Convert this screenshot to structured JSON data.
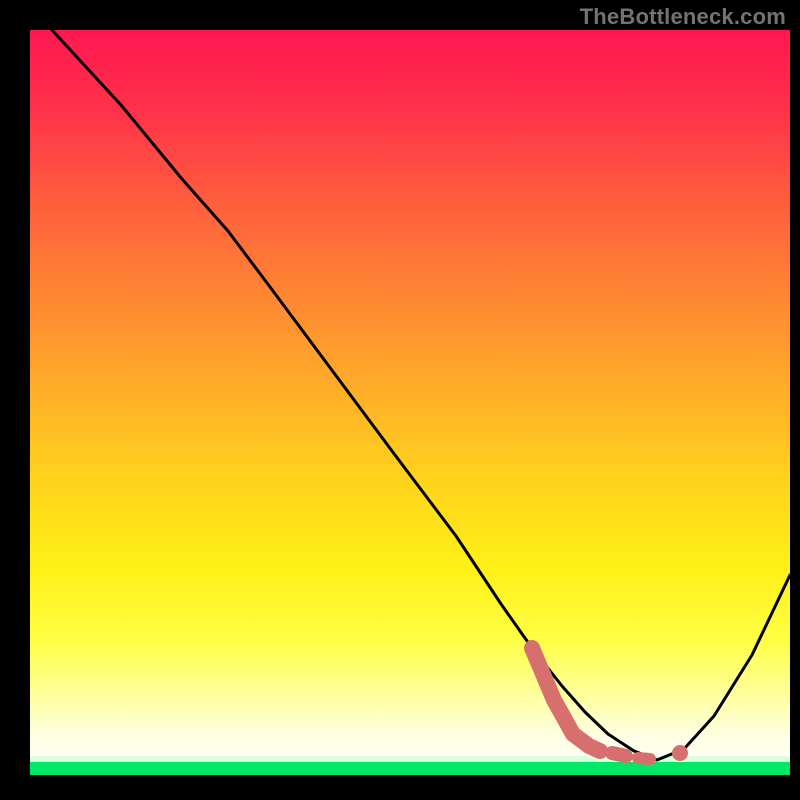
{
  "watermark": "TheBottleneck.com",
  "chart_data": {
    "type": "line",
    "title": "",
    "xlabel": "",
    "ylabel": "",
    "xlim": [
      0,
      100
    ],
    "ylim": [
      0,
      100
    ],
    "background_gradient_top": "#ff1a4d",
    "background_gradient_mid": "#ffd500",
    "background_gradient_low": "#ffff8a",
    "background_gradient_bottom_band": "#00e865",
    "series": [
      {
        "name": "bottleneck-curve",
        "color": "#000000",
        "x": [
          3,
          12,
          20,
          26,
          32,
          40,
          48,
          56,
          62,
          66,
          70,
          73,
          76,
          79.5,
          82.5,
          86,
          90,
          95,
          100
        ],
        "y": [
          100,
          90,
          80,
          73,
          65,
          54,
          43,
          32,
          23,
          17,
          12,
          8.5,
          5.5,
          3.2,
          2.0,
          3.5,
          8,
          16,
          27
        ]
      },
      {
        "name": "optimal-segment",
        "color": "#d66a6a",
        "style": "thick-dashed",
        "x": [
          66,
          69,
          71.5,
          73.5,
          75.5,
          77.5,
          79.5,
          82.5
        ],
        "y": [
          17,
          10,
          5.5,
          3.8,
          3.2,
          2.8,
          2.2,
          2.0
        ]
      },
      {
        "name": "optimal-point",
        "color": "#d66a6a",
        "style": "dot",
        "x": [
          85.5
        ],
        "y": [
          3.0
        ]
      }
    ]
  }
}
